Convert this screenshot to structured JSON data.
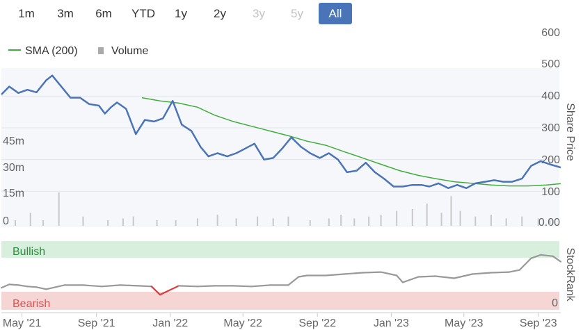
{
  "range_selector": {
    "buttons": [
      {
        "label": "1m",
        "state": "normal"
      },
      {
        "label": "3m",
        "state": "normal"
      },
      {
        "label": "6m",
        "state": "normal"
      },
      {
        "label": "YTD",
        "state": "normal"
      },
      {
        "label": "1y",
        "state": "normal"
      },
      {
        "label": "2y",
        "state": "normal"
      },
      {
        "label": "3y",
        "state": "disabled"
      },
      {
        "label": "5y",
        "state": "disabled"
      },
      {
        "label": "All",
        "state": "active"
      }
    ]
  },
  "colors": {
    "price": "#4a74b8",
    "sma": "#3fae3a",
    "volume": "#c8c8c8",
    "stockrank": "#999999",
    "stockrank_low": "#d93a3a",
    "bullish_band": "#d9efdd",
    "bullish_text": "#2e8b3e",
    "bearish_band": "#f6d5d5",
    "bearish_text": "#d9534f",
    "plot_bg": "#f6f7fb",
    "active_button": "#4a74b8"
  },
  "chart_data": [
    {
      "type": "line",
      "title": "",
      "legend": {
        "position": "top-left",
        "entries": [
          "SMA (200)",
          "Volume"
        ]
      },
      "ylabel": "Share Price",
      "ylim": [
        0,
        600
      ],
      "y_ticks": [
        "0.00",
        "100",
        "200",
        "300",
        "400",
        "500",
        "600"
      ],
      "volume_ticks": [
        "0",
        "15m",
        "30m",
        "45m"
      ],
      "volume_ylim": [
        0,
        60
      ],
      "x_ticks": [
        "May '21",
        "Sep '21",
        "Jan '22",
        "May '22",
        "Sep '22",
        "Jan '23",
        "May '23",
        "Sep '23"
      ],
      "x_range": [
        "2021-03-28",
        "2023-10-08"
      ],
      "grid": true,
      "series": [
        {
          "name": "",
          "kind": "price",
          "x": [
            "2021-03-28",
            "2021-04-10",
            "2021-04-25",
            "2021-05-10",
            "2021-05-25",
            "2021-06-10",
            "2021-06-20",
            "2021-07-05",
            "2021-07-20",
            "2021-08-05",
            "2021-08-20",
            "2021-09-05",
            "2021-09-15",
            "2021-09-25",
            "2021-10-05",
            "2021-10-20",
            "2021-11-05",
            "2021-11-20",
            "2021-12-05",
            "2021-12-20",
            "2022-01-05",
            "2022-01-20",
            "2022-02-05",
            "2022-02-20",
            "2022-03-05",
            "2022-03-20",
            "2022-04-05",
            "2022-04-20",
            "2022-05-05",
            "2022-05-20",
            "2022-06-05",
            "2022-06-20",
            "2022-07-05",
            "2022-07-20",
            "2022-08-05",
            "2022-08-20",
            "2022-09-05",
            "2022-09-20",
            "2022-10-05",
            "2022-10-20",
            "2022-11-05",
            "2022-11-20",
            "2022-12-05",
            "2022-12-20",
            "2023-01-05",
            "2023-01-20",
            "2023-02-05",
            "2023-02-20",
            "2023-03-05",
            "2023-03-20",
            "2023-04-05",
            "2023-04-20",
            "2023-05-05",
            "2023-05-20",
            "2023-06-05",
            "2023-06-20",
            "2023-07-05",
            "2023-07-20",
            "2023-08-05",
            "2023-08-20",
            "2023-09-05",
            "2023-09-20",
            "2023-10-08"
          ],
          "values": [
            405,
            430,
            410,
            420,
            412,
            450,
            465,
            430,
            395,
            395,
            375,
            370,
            345,
            365,
            380,
            360,
            280,
            325,
            320,
            330,
            385,
            310,
            290,
            240,
            210,
            220,
            210,
            220,
            235,
            250,
            200,
            205,
            235,
            270,
            240,
            220,
            205,
            220,
            200,
            160,
            165,
            190,
            160,
            140,
            115,
            115,
            120,
            120,
            115,
            125,
            110,
            120,
            110,
            125,
            130,
            135,
            130,
            130,
            140,
            180,
            195,
            185,
            175
          ]
        },
        {
          "name": "SMA (200)",
          "kind": "sma",
          "x": [
            "2021-11-15",
            "2021-12-15",
            "2022-01-15",
            "2022-02-15",
            "2022-03-15",
            "2022-04-15",
            "2022-05-15",
            "2022-06-15",
            "2022-07-15",
            "2022-08-15",
            "2022-09-15",
            "2022-10-15",
            "2022-11-15",
            "2022-12-15",
            "2023-01-15",
            "2023-02-15",
            "2023-03-15",
            "2023-04-15",
            "2023-05-15",
            "2023-06-15",
            "2023-07-15",
            "2023-08-15",
            "2023-09-15",
            "2023-10-08"
          ],
          "values": [
            395,
            385,
            378,
            365,
            340,
            320,
            305,
            290,
            275,
            258,
            245,
            225,
            205,
            185,
            165,
            150,
            140,
            130,
            125,
            120,
            117,
            117,
            120,
            124
          ]
        },
        {
          "name": "Volume",
          "kind": "volume",
          "x": [
            "2021-04-20",
            "2021-05-15",
            "2021-06-05",
            "2021-07-01",
            "2021-08-10",
            "2021-09-20",
            "2021-10-15",
            "2021-11-01",
            "2021-12-10",
            "2022-01-10",
            "2022-02-15",
            "2022-03-20",
            "2022-04-20",
            "2022-05-25",
            "2022-06-20",
            "2022-07-15",
            "2022-08-20",
            "2022-09-20",
            "2022-10-10",
            "2022-11-01",
            "2022-11-25",
            "2022-12-15",
            "2023-01-10",
            "2023-02-05",
            "2023-03-01",
            "2023-03-25",
            "2023-04-10",
            "2023-04-25",
            "2023-05-20",
            "2023-06-15",
            "2023-07-10",
            "2023-08-05",
            "2023-09-01",
            "2023-09-20"
          ],
          "values": [
            3,
            7,
            3,
            18,
            5,
            3,
            4,
            5,
            3,
            3,
            4,
            6,
            4,
            5,
            4,
            5,
            3,
            4,
            6,
            4,
            5,
            6,
            8,
            9,
            12,
            7,
            16,
            8,
            5,
            6,
            4,
            5,
            4,
            3
          ]
        }
      ]
    },
    {
      "type": "line",
      "title": "",
      "ylabel": "StockRank",
      "y_ticks": [
        "0"
      ],
      "ylim": [
        0,
        100
      ],
      "bands": [
        {
          "label": "Bullish",
          "range": [
            80,
            100
          ]
        },
        {
          "label": "Bearish",
          "range": [
            0,
            20
          ]
        }
      ],
      "series": [
        {
          "name": "StockRank",
          "x": [
            "2021-03-28",
            "2021-04-10",
            "2021-04-25",
            "2021-05-10",
            "2021-05-25",
            "2021-06-10",
            "2021-07-10",
            "2021-08-10",
            "2021-09-10",
            "2021-10-10",
            "2021-11-10",
            "2021-12-01",
            "2021-12-15",
            "2022-01-15",
            "2022-02-15",
            "2022-03-15",
            "2022-04-15",
            "2022-05-15",
            "2022-06-15",
            "2022-07-15",
            "2022-08-01",
            "2022-08-15",
            "2022-09-15",
            "2022-10-15",
            "2022-11-15",
            "2022-12-15",
            "2023-01-10",
            "2023-01-20",
            "2023-02-15",
            "2023-03-15",
            "2023-04-15",
            "2023-05-15",
            "2023-06-15",
            "2023-07-15",
            "2023-08-01",
            "2023-08-20",
            "2023-09-05",
            "2023-09-25",
            "2023-10-08"
          ],
          "values": [
            32,
            37,
            36,
            34,
            33,
            30,
            36,
            36,
            34,
            36,
            35,
            34,
            22,
            35,
            34,
            35,
            35,
            34,
            36,
            36,
            48,
            50,
            50,
            52,
            54,
            55,
            50,
            40,
            48,
            49,
            46,
            52,
            54,
            55,
            58,
            75,
            80,
            78,
            70
          ]
        }
      ]
    }
  ]
}
